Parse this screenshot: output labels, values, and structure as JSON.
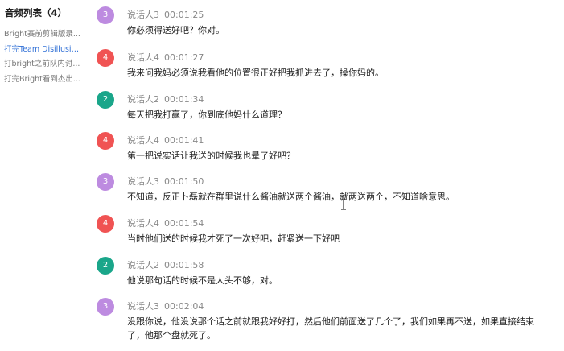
{
  "sidebar": {
    "title": "音频列表（4）",
    "files": [
      {
        "label": "Bright赛前剪辑版录..."
      },
      {
        "label": "打完Team Disillusio..."
      },
      {
        "label": "打bright之前队内讨..."
      },
      {
        "label": "打完Bright看到杰出..."
      }
    ],
    "active_index": 1
  },
  "colors": {
    "speaker2": "#1aa68a",
    "speaker3": "#bd8be0",
    "speaker4": "#f05353",
    "active_link": "#2f6fd6"
  },
  "messages": [
    {
      "avatar": "3",
      "speaker": "说话人3",
      "time": "00:01:25",
      "text": "你必须得送好吧？你对。"
    },
    {
      "avatar": "4",
      "speaker": "说话人4",
      "time": "00:01:27",
      "text": "我来问我妈必须说我看他的位置很正好把我抓进去了，操你妈的。"
    },
    {
      "avatar": "2",
      "speaker": "说话人2",
      "time": "00:01:34",
      "text": "每天把我打赢了，你到底他妈什么道理？"
    },
    {
      "avatar": "4",
      "speaker": "说话人4",
      "time": "00:01:41",
      "text": "第一把说实话让我送的时候我也晕了好吧？"
    },
    {
      "avatar": "3",
      "speaker": "说话人3",
      "time": "00:01:50",
      "text": "不知道，反正卜磊就在群里说什么酱油就送两个酱油，就两送两个，不知道啥意思。"
    },
    {
      "avatar": "4",
      "speaker": "说话人4",
      "time": "00:01:54",
      "text": "当时他们送的时候我才死了一次好吧，赶紧送一下好吧"
    },
    {
      "avatar": "2",
      "speaker": "说话人2",
      "time": "00:01:58",
      "text": "他说那句话的时候不是人头不够，对。"
    },
    {
      "avatar": "3",
      "speaker": "说话人3",
      "time": "00:02:04",
      "text": "没跟你说，他没说那个话之前就跟我好好打，然后他们前面送了几个了，我们如果再不送，如果直接结束了，他那个盘就死了。"
    }
  ]
}
